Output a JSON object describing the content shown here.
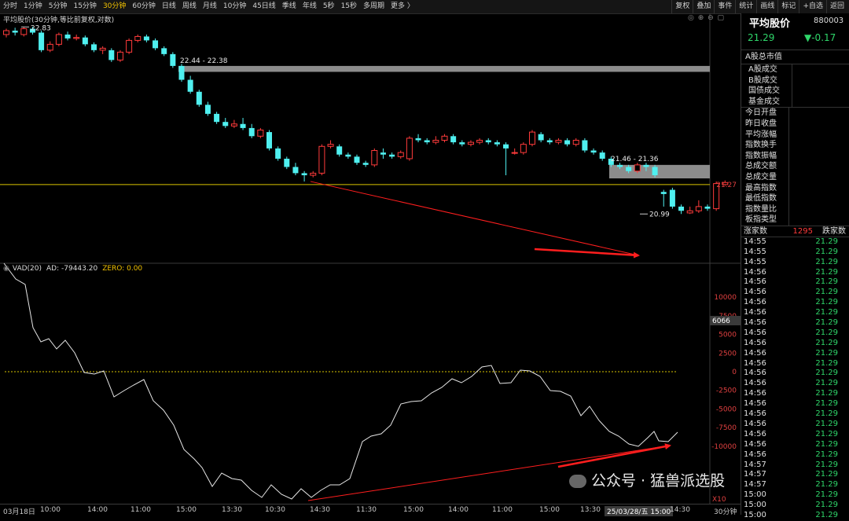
{
  "toolbar": {
    "periods": [
      "分时",
      "1分钟",
      "5分钟",
      "15分钟",
      "30分钟",
      "60分钟",
      "日线",
      "周线",
      "月线",
      "10分钟",
      "45日线",
      "季线",
      "年线",
      "5秒",
      "15秒",
      "多周期",
      "更多 〉"
    ],
    "active_period": "30分钟",
    "actions": [
      "复权",
      "叠加",
      "事件",
      "统计",
      "画线",
      "标记",
      "+自选",
      "返回"
    ]
  },
  "main_chart": {
    "title": "平均股价(30分钟,等比前复权,对数)",
    "marker_high": "22.83",
    "zone1_label": "22.44 - 22.38",
    "zone2_label": "21.46 - 21.36",
    "marker_low": "20.99",
    "price_line_value": "21.27",
    "colors": {
      "up": "#ff3b3b",
      "down": "#4ff0f0",
      "zone": "#8c8c8c",
      "price_line": "#d9c400",
      "arrow": "#ff1e1e"
    }
  },
  "vad": {
    "label": "VAD(20)",
    "ad_text": "AD: -79443.20",
    "zero_text": "ZERO: 0.00",
    "current_value": "6066",
    "axis_ticks": [
      "10000",
      "7500",
      "5000",
      "2500",
      "0",
      "-2500",
      "-5000",
      "-7500",
      "-10000"
    ],
    "multiplier": "X10"
  },
  "xaxis": {
    "labels": [
      "03月18日",
      "10:00",
      "14:00",
      "11:00",
      "15:00",
      "13:30",
      "10:30",
      "14:30",
      "11:30",
      "15:00",
      "14:00",
      "11:00",
      "15:00",
      "13:30",
      "25/03/28/五 15:00",
      "14:30",
      "30分钟"
    ]
  },
  "side_panel": {
    "title": "平均股价",
    "code": "880003",
    "price": "21.29",
    "change": "▼-0.17",
    "market_cap_label": "A股总市值",
    "turnover_labels": [
      "A股成交",
      "B股成交",
      "国债成交",
      "基金成交"
    ],
    "stats_labels": [
      "今日开盘",
      "昨日收盘",
      "平均涨幅",
      "指数换手",
      "指数振幅",
      "总成交额",
      "总成交量",
      "最高指数",
      "最低指数",
      "指数量比",
      "板指类型"
    ],
    "rise_label": "涨家数",
    "rise_count": "1295",
    "fall_label": "跌家数",
    "ticks": [
      {
        "t": "14:55",
        "p": "21.29"
      },
      {
        "t": "14:55",
        "p": "21.29"
      },
      {
        "t": "14:55",
        "p": "21.29"
      },
      {
        "t": "14:56",
        "p": "21.29"
      },
      {
        "t": "14:56",
        "p": "21.29"
      },
      {
        "t": "14:56",
        "p": "21.29"
      },
      {
        "t": "14:56",
        "p": "21.29"
      },
      {
        "t": "14:56",
        "p": "21.29"
      },
      {
        "t": "14:56",
        "p": "21.29"
      },
      {
        "t": "14:56",
        "p": "21.29"
      },
      {
        "t": "14:56",
        "p": "21.29"
      },
      {
        "t": "14:56",
        "p": "21.29"
      },
      {
        "t": "14:56",
        "p": "21.29"
      },
      {
        "t": "14:56",
        "p": "21.29"
      },
      {
        "t": "14:56",
        "p": "21.29"
      },
      {
        "t": "14:56",
        "p": "21.29"
      },
      {
        "t": "14:56",
        "p": "21.29"
      },
      {
        "t": "14:56",
        "p": "21.29"
      },
      {
        "t": "14:56",
        "p": "21.29"
      },
      {
        "t": "14:56",
        "p": "21.29"
      },
      {
        "t": "14:56",
        "p": "21.29"
      },
      {
        "t": "14:56",
        "p": "21.29"
      },
      {
        "t": "14:57",
        "p": "21.29"
      },
      {
        "t": "14:57",
        "p": "21.29"
      },
      {
        "t": "14:57",
        "p": "21.29"
      },
      {
        "t": "15:00",
        "p": "21.29"
      },
      {
        "t": "15:00",
        "p": "21.29"
      },
      {
        "t": "15:00",
        "p": "21.29"
      }
    ]
  },
  "watermark": {
    "text": "公众号 · 猛兽派选股"
  },
  "candles": [
    {
      "o": 22.76,
      "c": 22.8,
      "h": 22.82,
      "l": 22.73
    },
    {
      "o": 22.8,
      "c": 22.78,
      "h": 22.83,
      "l": 22.75
    },
    {
      "o": 22.76,
      "c": 22.82,
      "h": 22.84,
      "l": 22.74
    },
    {
      "o": 22.82,
      "c": 22.78,
      "h": 22.84,
      "l": 22.76
    },
    {
      "o": 22.78,
      "c": 22.6,
      "h": 22.8,
      "l": 22.58
    },
    {
      "o": 22.6,
      "c": 22.66,
      "h": 22.69,
      "l": 22.58
    },
    {
      "o": 22.66,
      "c": 22.76,
      "h": 22.78,
      "l": 22.64
    },
    {
      "o": 22.76,
      "c": 22.72,
      "h": 22.79,
      "l": 22.7
    },
    {
      "o": 22.72,
      "c": 22.73,
      "h": 22.76,
      "l": 22.7
    },
    {
      "o": 22.73,
      "c": 22.66,
      "h": 22.75,
      "l": 22.64
    },
    {
      "o": 22.66,
      "c": 22.6,
      "h": 22.68,
      "l": 22.58
    },
    {
      "o": 22.6,
      "c": 22.62,
      "h": 22.64,
      "l": 22.56
    },
    {
      "o": 22.6,
      "c": 22.5,
      "h": 22.62,
      "l": 22.48
    },
    {
      "o": 22.5,
      "c": 22.58,
      "h": 22.6,
      "l": 22.48
    },
    {
      "o": 22.58,
      "c": 22.7,
      "h": 22.72,
      "l": 22.56
    },
    {
      "o": 22.7,
      "c": 22.74,
      "h": 22.76,
      "l": 22.68
    },
    {
      "o": 22.74,
      "c": 22.7,
      "h": 22.76,
      "l": 22.68
    },
    {
      "o": 22.7,
      "c": 22.62,
      "h": 22.72,
      "l": 22.6
    },
    {
      "o": 22.62,
      "c": 22.56,
      "h": 22.64,
      "l": 22.54
    },
    {
      "o": 22.56,
      "c": 22.44,
      "h": 22.58,
      "l": 22.42
    },
    {
      "o": 22.44,
      "c": 22.3,
      "h": 22.46,
      "l": 22.28
    },
    {
      "o": 22.3,
      "c": 22.18,
      "h": 22.34,
      "l": 22.16
    },
    {
      "o": 22.18,
      "c": 22.05,
      "h": 22.2,
      "l": 22.03
    },
    {
      "o": 22.05,
      "c": 21.96,
      "h": 22.08,
      "l": 21.94
    },
    {
      "o": 21.96,
      "c": 21.88,
      "h": 21.98,
      "l": 21.86
    },
    {
      "o": 21.88,
      "c": 21.84,
      "h": 21.92,
      "l": 21.82
    },
    {
      "o": 21.84,
      "c": 21.86,
      "h": 21.9,
      "l": 21.82
    },
    {
      "o": 21.86,
      "c": 21.82,
      "h": 21.92,
      "l": 21.8
    },
    {
      "o": 21.82,
      "c": 21.74,
      "h": 21.86,
      "l": 21.72
    },
    {
      "o": 21.74,
      "c": 21.8,
      "h": 21.82,
      "l": 21.72
    },
    {
      "o": 21.78,
      "c": 21.62,
      "h": 21.8,
      "l": 21.6
    },
    {
      "o": 21.62,
      "c": 21.52,
      "h": 21.64,
      "l": 21.5
    },
    {
      "o": 21.52,
      "c": 21.44,
      "h": 21.54,
      "l": 21.42
    },
    {
      "o": 21.44,
      "c": 21.38,
      "h": 21.48,
      "l": 21.36
    },
    {
      "o": 21.38,
      "c": 21.36,
      "h": 21.4,
      "l": 21.3
    },
    {
      "o": 21.36,
      "c": 21.38,
      "h": 21.4,
      "l": 21.34
    },
    {
      "o": 21.38,
      "c": 21.64,
      "h": 21.66,
      "l": 21.36
    },
    {
      "o": 21.64,
      "c": 21.66,
      "h": 21.7,
      "l": 21.62
    },
    {
      "o": 21.64,
      "c": 21.56,
      "h": 21.66,
      "l": 21.54
    },
    {
      "o": 21.56,
      "c": 21.54,
      "h": 21.58,
      "l": 21.52
    },
    {
      "o": 21.54,
      "c": 21.48,
      "h": 21.56,
      "l": 21.46
    },
    {
      "o": 21.48,
      "c": 21.46,
      "h": 21.5,
      "l": 21.44
    },
    {
      "o": 21.46,
      "c": 21.6,
      "h": 21.62,
      "l": 21.44
    },
    {
      "o": 21.58,
      "c": 21.56,
      "h": 21.62,
      "l": 21.52
    },
    {
      "o": 21.56,
      "c": 21.54,
      "h": 21.58,
      "l": 21.52
    },
    {
      "o": 21.54,
      "c": 21.58,
      "h": 21.6,
      "l": 21.52
    },
    {
      "o": 21.52,
      "c": 21.72,
      "h": 21.74,
      "l": 21.5
    },
    {
      "o": 21.72,
      "c": 21.7,
      "h": 21.76,
      "l": 21.68
    },
    {
      "o": 21.7,
      "c": 21.68,
      "h": 21.72,
      "l": 21.66
    },
    {
      "o": 21.68,
      "c": 21.7,
      "h": 21.74,
      "l": 21.66
    },
    {
      "o": 21.7,
      "c": 21.74,
      "h": 21.76,
      "l": 21.68
    },
    {
      "o": 21.74,
      "c": 21.68,
      "h": 21.76,
      "l": 21.66
    },
    {
      "o": 21.68,
      "c": 21.66,
      "h": 21.7,
      "l": 21.64
    },
    {
      "o": 21.66,
      "c": 21.68,
      "h": 21.7,
      "l": 21.64
    },
    {
      "o": 21.68,
      "c": 21.7,
      "h": 21.72,
      "l": 21.66
    },
    {
      "o": 21.7,
      "c": 21.68,
      "h": 21.72,
      "l": 21.66
    },
    {
      "o": 21.68,
      "c": 21.66,
      "h": 21.7,
      "l": 21.64
    },
    {
      "o": 21.66,
      "c": 21.62,
      "h": 21.68,
      "l": 21.36
    },
    {
      "o": 21.58,
      "c": 21.58,
      "h": 21.62,
      "l": 21.56
    },
    {
      "o": 21.58,
      "c": 21.66,
      "h": 21.68,
      "l": 21.56
    },
    {
      "o": 21.66,
      "c": 21.78,
      "h": 21.8,
      "l": 21.64
    },
    {
      "o": 21.76,
      "c": 21.7,
      "h": 21.78,
      "l": 21.68
    },
    {
      "o": 21.7,
      "c": 21.68,
      "h": 21.72,
      "l": 21.66
    },
    {
      "o": 21.68,
      "c": 21.7,
      "h": 21.72,
      "l": 21.66
    },
    {
      "o": 21.7,
      "c": 21.66,
      "h": 21.72,
      "l": 21.64
    },
    {
      "o": 21.66,
      "c": 21.7,
      "h": 21.72,
      "l": 21.64
    },
    {
      "o": 21.7,
      "c": 21.6,
      "h": 21.72,
      "l": 21.58
    },
    {
      "o": 21.6,
      "c": 21.58,
      "h": 21.62,
      "l": 21.56
    },
    {
      "o": 21.58,
      "c": 21.52,
      "h": 21.6,
      "l": 21.5
    },
    {
      "o": 21.52,
      "c": 21.46,
      "h": 21.54,
      "l": 21.44
    },
    {
      "o": 21.46,
      "c": 21.44,
      "h": 21.48,
      "l": 21.42
    },
    {
      "o": 21.44,
      "c": 21.4,
      "h": 21.46,
      "l": 21.38
    },
    {
      "o": 21.4,
      "c": 21.46,
      "h": 21.48,
      "l": 21.38
    },
    {
      "o": 21.46,
      "c": 21.44,
      "h": 21.48,
      "l": 21.4
    },
    {
      "o": 21.44,
      "c": 21.36,
      "h": 21.46,
      "l": 21.34
    },
    {
      "o": 21.2,
      "c": 21.18,
      "h": 21.22,
      "l": 21.06
    },
    {
      "o": 21.22,
      "c": 21.06,
      "h": 21.24,
      "l": 21.04
    },
    {
      "o": 21.06,
      "c": 21.02,
      "h": 21.08,
      "l": 20.99
    },
    {
      "o": 21.0,
      "c": 21.02,
      "h": 21.06,
      "l": 20.99
    },
    {
      "o": 21.02,
      "c": 21.06,
      "h": 21.12,
      "l": 21.0
    },
    {
      "o": 21.06,
      "c": 21.04,
      "h": 21.08,
      "l": 21.02
    },
    {
      "o": 21.04,
      "c": 21.28,
      "h": 21.3,
      "l": 21.02
    },
    {
      "o": 21.27,
      "c": 21.29,
      "h": 21.31,
      "l": 21.26
    }
  ]
}
